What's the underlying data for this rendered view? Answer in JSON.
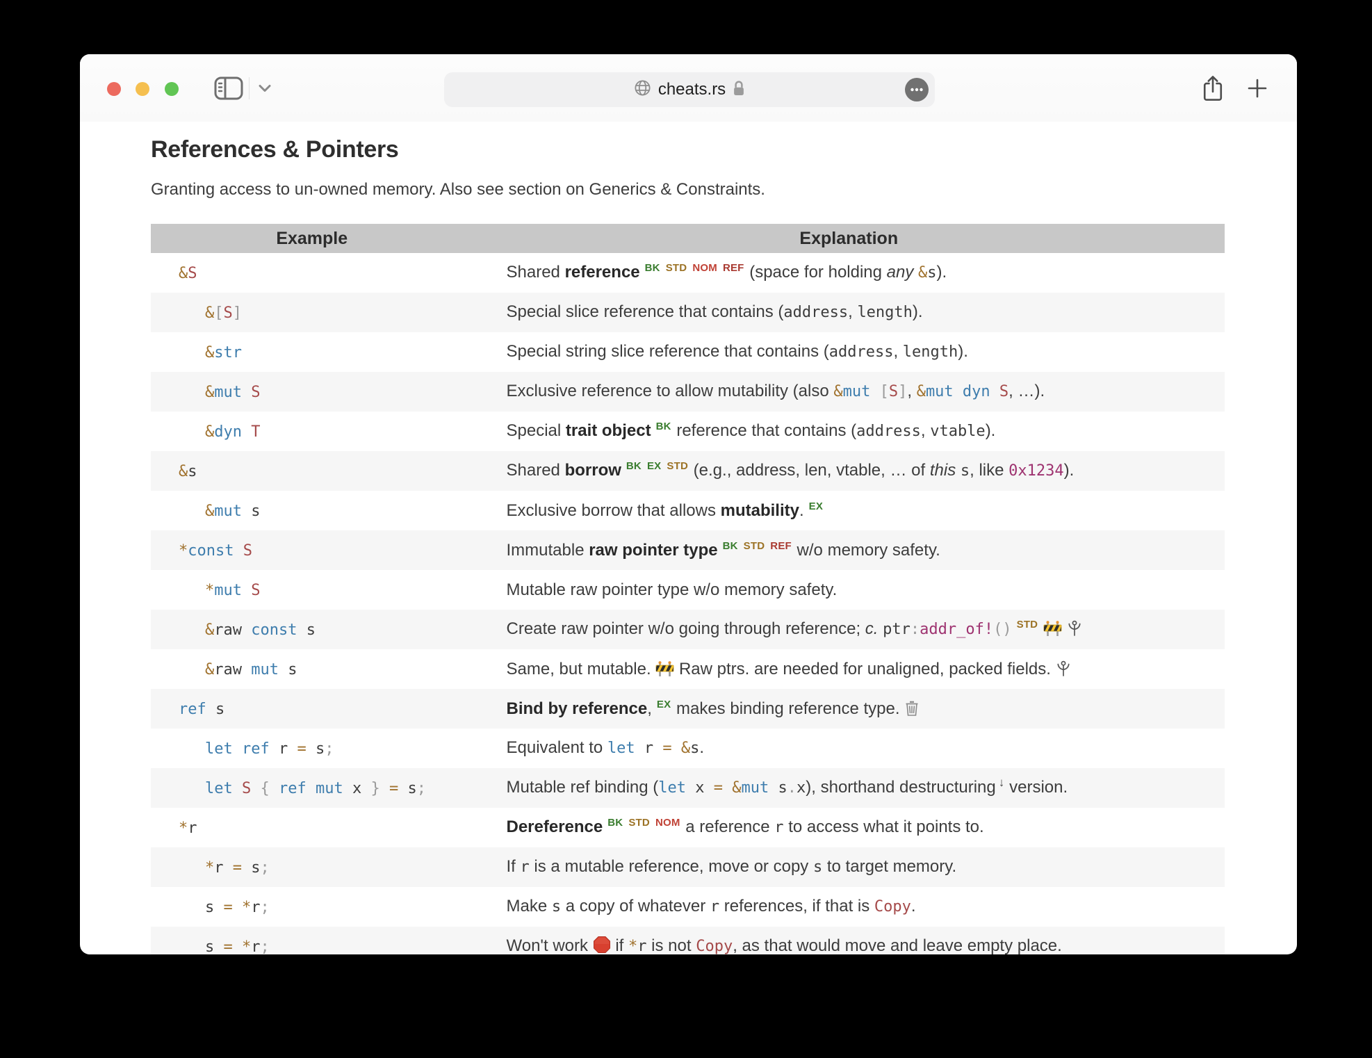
{
  "window": {
    "url": "cheats.rs"
  },
  "page": {
    "title": "References & Pointers",
    "subtitle": "Granting access to un-owned memory. Also see section on Generics & Constraints."
  },
  "table": {
    "headers": {
      "example": "Example",
      "explanation": "Explanation"
    },
    "rows": [
      {
        "indent": 0,
        "code": [
          {
            "t": "&",
            "c": "op"
          },
          {
            "t": "S",
            "c": "ty"
          }
        ],
        "expl": [
          {
            "t": "Shared "
          },
          {
            "t": "reference",
            "c": "b"
          },
          {
            "t": "BK",
            "c": "sg"
          },
          {
            "t": "STD",
            "c": "so"
          },
          {
            "t": "NOM",
            "c": "sr"
          },
          {
            "t": "REF",
            "c": "sq"
          },
          {
            "t": " (space for holding "
          },
          {
            "t": "any",
            "c": "i"
          },
          {
            "t": " "
          },
          {
            "t": "&",
            "c": "op"
          },
          {
            "t": "s",
            "c": "id"
          },
          {
            "t": ")."
          }
        ]
      },
      {
        "indent": 1,
        "code": [
          {
            "t": "&",
            "c": "op"
          },
          {
            "t": "[",
            "c": "pu"
          },
          {
            "t": "S",
            "c": "ty"
          },
          {
            "t": "]",
            "c": "pu"
          }
        ],
        "expl": [
          {
            "t": "Special slice reference that contains ("
          },
          {
            "t": "address",
            "c": "id"
          },
          {
            "t": ", "
          },
          {
            "t": "length",
            "c": "id"
          },
          {
            "t": ")."
          }
        ]
      },
      {
        "indent": 1,
        "code": [
          {
            "t": "&",
            "c": "op"
          },
          {
            "t": "str",
            "c": "kw"
          }
        ],
        "expl": [
          {
            "t": "Special string slice reference that contains ("
          },
          {
            "t": "address",
            "c": "id"
          },
          {
            "t": ", "
          },
          {
            "t": "length",
            "c": "id"
          },
          {
            "t": ")."
          }
        ]
      },
      {
        "indent": 1,
        "code": [
          {
            "t": "&",
            "c": "op"
          },
          {
            "t": "mut ",
            "c": "kw"
          },
          {
            "t": "S",
            "c": "ty"
          }
        ],
        "expl": [
          {
            "t": "Exclusive reference to allow mutability (also "
          },
          {
            "t": "&",
            "c": "op"
          },
          {
            "t": "mut ",
            "c": "kw"
          },
          {
            "t": "[",
            "c": "pu"
          },
          {
            "t": "S",
            "c": "ty"
          },
          {
            "t": "]",
            "c": "pu"
          },
          {
            "t": ", "
          },
          {
            "t": "&",
            "c": "op"
          },
          {
            "t": "mut ",
            "c": "kw"
          },
          {
            "t": "dyn ",
            "c": "kw"
          },
          {
            "t": "S",
            "c": "ty"
          },
          {
            "t": ", …)."
          }
        ]
      },
      {
        "indent": 1,
        "code": [
          {
            "t": "&",
            "c": "op"
          },
          {
            "t": "dyn ",
            "c": "kw"
          },
          {
            "t": "T",
            "c": "ty"
          }
        ],
        "expl": [
          {
            "t": "Special "
          },
          {
            "t": "trait object",
            "c": "b"
          },
          {
            "t": "BK",
            "c": "sg"
          },
          {
            "t": " reference that contains ("
          },
          {
            "t": "address",
            "c": "id"
          },
          {
            "t": ", "
          },
          {
            "t": "vtable",
            "c": "id"
          },
          {
            "t": ")."
          }
        ]
      },
      {
        "indent": 0,
        "code": [
          {
            "t": "&",
            "c": "op"
          },
          {
            "t": "s",
            "c": "id"
          }
        ],
        "expl": [
          {
            "t": "Shared "
          },
          {
            "t": "borrow",
            "c": "b"
          },
          {
            "t": "BK",
            "c": "sg"
          },
          {
            "t": "EX",
            "c": "sg"
          },
          {
            "t": "STD",
            "c": "so"
          },
          {
            "t": " (e.g., address, len, vtable, … of "
          },
          {
            "t": "this",
            "c": "i"
          },
          {
            "t": " "
          },
          {
            "t": "s",
            "c": "id"
          },
          {
            "t": ", like "
          },
          {
            "t": "0x1234",
            "c": "num"
          },
          {
            "t": ")."
          }
        ]
      },
      {
        "indent": 1,
        "code": [
          {
            "t": "&",
            "c": "op"
          },
          {
            "t": "mut ",
            "c": "kw"
          },
          {
            "t": "s",
            "c": "id"
          }
        ],
        "expl": [
          {
            "t": "Exclusive borrow that allows "
          },
          {
            "t": "mutability",
            "c": "b"
          },
          {
            "t": "."
          },
          {
            "t": "EX",
            "c": "sg"
          }
        ]
      },
      {
        "indent": 0,
        "code": [
          {
            "t": "*",
            "c": "op"
          },
          {
            "t": "const ",
            "c": "kw"
          },
          {
            "t": "S",
            "c": "ty"
          }
        ],
        "expl": [
          {
            "t": "Immutable "
          },
          {
            "t": "raw pointer type",
            "c": "b"
          },
          {
            "t": "BK",
            "c": "sg"
          },
          {
            "t": "STD",
            "c": "so"
          },
          {
            "t": "REF",
            "c": "sq"
          },
          {
            "t": " w/o memory safety."
          }
        ]
      },
      {
        "indent": 1,
        "code": [
          {
            "t": "*",
            "c": "op"
          },
          {
            "t": "mut ",
            "c": "kw"
          },
          {
            "t": "S",
            "c": "ty"
          }
        ],
        "expl": [
          {
            "t": "Mutable raw pointer type w/o memory safety."
          }
        ]
      },
      {
        "indent": 1,
        "code": [
          {
            "t": "&",
            "c": "op"
          },
          {
            "t": "raw ",
            "c": "id"
          },
          {
            "t": "const ",
            "c": "kw"
          },
          {
            "t": "s",
            "c": "id"
          }
        ],
        "expl": [
          {
            "t": "Create raw pointer w/o going through reference; "
          },
          {
            "t": "c.",
            "c": "i"
          },
          {
            "t": " "
          },
          {
            "t": "ptr",
            "c": "id"
          },
          {
            "t": ":",
            "c": "pu"
          },
          {
            "t": "addr_of!",
            "c": "num"
          },
          {
            "t": "()",
            "c": "pu"
          },
          {
            "t": "STD",
            "c": "so"
          },
          {
            "t": " "
          },
          {
            "ic": "construction"
          },
          {
            "t": " "
          },
          {
            "ic": "flower"
          }
        ]
      },
      {
        "indent": 1,
        "code": [
          {
            "t": "&",
            "c": "op"
          },
          {
            "t": "raw ",
            "c": "id"
          },
          {
            "t": "mut ",
            "c": "kw"
          },
          {
            "t": "s",
            "c": "id"
          }
        ],
        "expl": [
          {
            "t": "Same, but mutable. "
          },
          {
            "ic": "construction"
          },
          {
            "t": " Raw ptrs. are needed for unaligned, packed fields. "
          },
          {
            "ic": "flower"
          }
        ]
      },
      {
        "indent": 0,
        "code": [
          {
            "t": "ref ",
            "c": "kw"
          },
          {
            "t": "s",
            "c": "id"
          }
        ],
        "expl": [
          {
            "t": "Bind by reference",
            "c": "b"
          },
          {
            "t": ","
          },
          {
            "t": "EX",
            "c": "sg"
          },
          {
            "t": " makes binding reference type. "
          },
          {
            "ic": "trash"
          }
        ]
      },
      {
        "indent": 1,
        "code": [
          {
            "t": "let ref ",
            "c": "kw"
          },
          {
            "t": "r ",
            "c": "id"
          },
          {
            "t": "= ",
            "c": "op"
          },
          {
            "t": "s",
            "c": "id"
          },
          {
            "t": ";",
            "c": "pu"
          }
        ],
        "expl": [
          {
            "t": "Equivalent to "
          },
          {
            "t": "let ",
            "c": "kw"
          },
          {
            "t": "r ",
            "c": "id"
          },
          {
            "t": "= ",
            "c": "op"
          },
          {
            "t": "&",
            "c": "op"
          },
          {
            "t": "s",
            "c": "id"
          },
          {
            "t": "."
          }
        ]
      },
      {
        "indent": 1,
        "code": [
          {
            "t": "let ",
            "c": "kw"
          },
          {
            "t": "S ",
            "c": "ty"
          },
          {
            "t": "{ ",
            "c": "pu"
          },
          {
            "t": "ref mut ",
            "c": "kw"
          },
          {
            "t": "x ",
            "c": "id"
          },
          {
            "t": "} ",
            "c": "pu"
          },
          {
            "t": "= ",
            "c": "op"
          },
          {
            "t": "s",
            "c": "id"
          },
          {
            "t": ";",
            "c": "pu"
          }
        ],
        "expl": [
          {
            "t": "Mutable ref binding ("
          },
          {
            "t": "let ",
            "c": "kw"
          },
          {
            "t": "x ",
            "c": "id"
          },
          {
            "t": "= ",
            "c": "op"
          },
          {
            "t": "&",
            "c": "op"
          },
          {
            "t": "mut ",
            "c": "kw"
          },
          {
            "t": "s",
            "c": "id"
          },
          {
            "t": ".",
            "c": "pu"
          },
          {
            "t": "x",
            "c": "id"
          },
          {
            "t": "), shorthand destructuring"
          },
          {
            "t": "↓",
            "c": "sk"
          },
          {
            "t": " version."
          }
        ]
      },
      {
        "indent": 0,
        "code": [
          {
            "t": "*",
            "c": "op"
          },
          {
            "t": "r",
            "c": "id"
          }
        ],
        "expl": [
          {
            "t": "Dereference",
            "c": "b"
          },
          {
            "t": "BK",
            "c": "sg"
          },
          {
            "t": "STD",
            "c": "so"
          },
          {
            "t": "NOM",
            "c": "sr"
          },
          {
            "t": " a reference "
          },
          {
            "t": "r",
            "c": "id"
          },
          {
            "t": " to access what it points to."
          }
        ]
      },
      {
        "indent": 1,
        "code": [
          {
            "t": "*",
            "c": "op"
          },
          {
            "t": "r ",
            "c": "id"
          },
          {
            "t": "= ",
            "c": "op"
          },
          {
            "t": "s",
            "c": "id"
          },
          {
            "t": ";",
            "c": "pu"
          }
        ],
        "expl": [
          {
            "t": "If "
          },
          {
            "t": "r",
            "c": "id"
          },
          {
            "t": " is a mutable reference, move or copy "
          },
          {
            "t": "s",
            "c": "id"
          },
          {
            "t": " to target memory."
          }
        ]
      },
      {
        "indent": 1,
        "code": [
          {
            "t": "s ",
            "c": "id"
          },
          {
            "t": "= ",
            "c": "op"
          },
          {
            "t": "*",
            "c": "op"
          },
          {
            "t": "r",
            "c": "id"
          },
          {
            "t": ";",
            "c": "pu"
          }
        ],
        "expl": [
          {
            "t": "Make "
          },
          {
            "t": "s",
            "c": "id"
          },
          {
            "t": " a copy of whatever "
          },
          {
            "t": "r",
            "c": "id"
          },
          {
            "t": " references, if that is "
          },
          {
            "t": "Copy",
            "c": "ty"
          },
          {
            "t": "."
          }
        ]
      },
      {
        "indent": 1,
        "code": [
          {
            "t": "s ",
            "c": "id"
          },
          {
            "t": "= ",
            "c": "op"
          },
          {
            "t": "*",
            "c": "op"
          },
          {
            "t": "r",
            "c": "id"
          },
          {
            "t": ";",
            "c": "pu"
          }
        ],
        "expl": [
          {
            "t": "Won't work "
          },
          {
            "ic": "stop"
          },
          {
            "t": " if "
          },
          {
            "t": "*",
            "c": "op"
          },
          {
            "t": "r",
            "c": "id"
          },
          {
            "t": " is not "
          },
          {
            "t": "Copy",
            "c": "ty"
          },
          {
            "t": ", as that would move and leave empty place."
          }
        ]
      }
    ]
  },
  "colors": {
    "kw": "#3e7dad",
    "ty": "#a54a4a",
    "op": "#a0722e",
    "id": "#3d3d3d",
    "pu": "#9a9a9a",
    "num": "#9e3370",
    "sup_green": "#3a7d2f",
    "sup_gold": "#9c7326",
    "sup_red": "#c04236",
    "sup_darkred": "#a93a31",
    "header_bg": "#c8c8c8",
    "row_alt_bg": "#f6f6f6",
    "text": "#3d3d3d",
    "traffic_red": "#ec6a5e",
    "traffic_yellow": "#f5bf4f",
    "traffic_green": "#61c554"
  }
}
